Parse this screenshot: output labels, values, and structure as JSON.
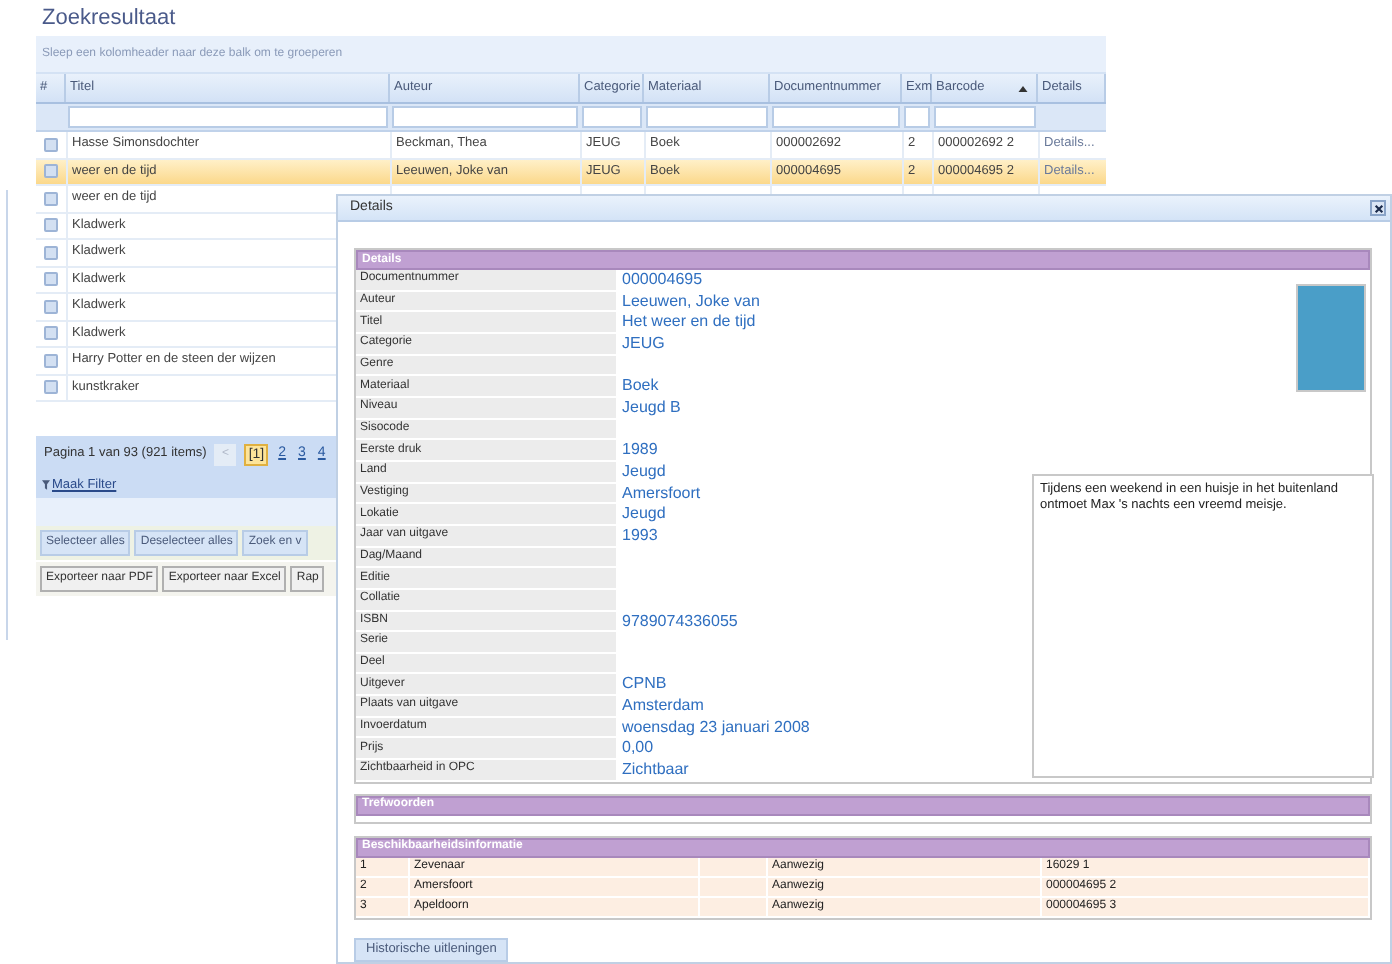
{
  "page_title": "Zoekresultaat",
  "grid": {
    "group_hint": "Sleep een kolomheader naar deze balk om te groeperen",
    "columns": [
      {
        "label": "#",
        "sorted": false
      },
      {
        "label": "Titel",
        "sorted": false
      },
      {
        "label": "Auteur",
        "sorted": false
      },
      {
        "label": "Categorie",
        "sorted": false
      },
      {
        "label": "Materiaal",
        "sorted": false
      },
      {
        "label": "Documentnummer",
        "sorted": false
      },
      {
        "label": "Exm",
        "sorted": false
      },
      {
        "label": "Barcode",
        "sorted": true
      },
      {
        "label": "Details",
        "sorted": false
      }
    ],
    "rows": [
      {
        "checked": false,
        "selected": false,
        "cells": [
          "",
          "Hasse Simonsdochter",
          "Beckman, Thea",
          "JEUG",
          "Boek",
          "000002692",
          "2",
          "000002692 2",
          "Details..."
        ]
      },
      {
        "checked": false,
        "selected": true,
        "cells": [
          "",
          "weer en de tijd",
          "Leeuwen, Joke van",
          "JEUG",
          "Boek",
          "000004695",
          "2",
          "000004695 2",
          "Details..."
        ]
      },
      {
        "checked": false,
        "selected": false,
        "cells": [
          "",
          "weer en de tijd"
        ]
      },
      {
        "checked": false,
        "selected": false,
        "cells": [
          "",
          "Kladwerk"
        ]
      },
      {
        "checked": false,
        "selected": false,
        "cells": [
          "",
          "Kladwerk"
        ]
      },
      {
        "checked": false,
        "selected": false,
        "cells": [
          "",
          "Kladwerk"
        ]
      },
      {
        "checked": false,
        "selected": false,
        "cells": [
          "",
          "Kladwerk"
        ]
      },
      {
        "checked": false,
        "selected": false,
        "cells": [
          "",
          "Kladwerk"
        ]
      },
      {
        "checked": false,
        "selected": false,
        "cells": [
          "",
          "Harry Potter en de steen der wijzen"
        ]
      },
      {
        "checked": false,
        "selected": false,
        "cells": [
          "",
          "kunstkraker"
        ]
      }
    ]
  },
  "pager": {
    "summary": "Pagina 1 van 93 (921 items)",
    "prev": {
      "label": "<",
      "disabled": true
    },
    "pages": [
      {
        "label": "[1]",
        "selected": true
      },
      {
        "label": "2",
        "selected": false
      },
      {
        "label": "3",
        "selected": false
      },
      {
        "label": "4",
        "selected": false
      }
    ]
  },
  "filter_link": "Maak Filter",
  "button_rows": [
    [
      "Selecteer alles",
      "Deselecteer alles",
      "Zoek en v"
    ],
    [
      "Exporteer naar PDF",
      "Exporteer naar Excel",
      "Rap"
    ]
  ],
  "dialog": {
    "title": "Details",
    "details_header": "Details",
    "fields": [
      {
        "label": "Documentnummer",
        "value": "000004695"
      },
      {
        "label": "Auteur",
        "value": "Leeuwen, Joke van"
      },
      {
        "label": "Titel",
        "value": "Het weer en de tijd"
      },
      {
        "label": "Categorie",
        "value": "JEUG"
      },
      {
        "label": "Genre"
      },
      {
        "label": "Materiaal",
        "value": "Boek"
      },
      {
        "label": "Niveau",
        "value": "Jeugd B"
      },
      {
        "label": "Sisocode"
      },
      {
        "label": "Eerste druk",
        "value": "1989"
      },
      {
        "label": "Land",
        "value": "Jeugd"
      },
      {
        "label": "Vestiging",
        "value": "Amersfoort"
      },
      {
        "label": "Lokatie",
        "value": "Jeugd"
      },
      {
        "label": "Jaar van uitgave",
        "value": "1993"
      },
      {
        "label": "Dag/Maand"
      },
      {
        "label": "Editie"
      },
      {
        "label": "Collatie"
      },
      {
        "label": "ISBN",
        "value": "9789074336055"
      },
      {
        "label": "Serie"
      },
      {
        "label": "Deel"
      },
      {
        "label": "Uitgever",
        "value": "CPNB"
      },
      {
        "label": "Plaats van uitgave",
        "value": "Amsterdam"
      },
      {
        "label": "Invoerdatum",
        "value": "woensdag 23 januari 2008"
      },
      {
        "label": "Prijs",
        "value": "0,00"
      },
      {
        "label": "Zichtbaarheid in OPC",
        "value": "Zichtbaar"
      }
    ],
    "description": "Tijdens een weekend in een huisje in het buitenland ontmoet Max 's nachts een vreemd meisje.",
    "keywords_header": "Trefwoorden",
    "availability_header": "Beschikbaarheidsinformatie",
    "availability": [
      {
        "number": "1",
        "location": "Zevenaar",
        "status": "Aanwezig",
        "barcode": "16029 1"
      },
      {
        "number": "2",
        "location": "Amersfoort",
        "status": "Aanwezig",
        "barcode": "000004695 2"
      },
      {
        "number": "3",
        "location": "Apeldoorn",
        "status": "Aanwezig",
        "barcode": "000004695 3"
      }
    ],
    "history_button": "Historische uitleningen"
  }
}
